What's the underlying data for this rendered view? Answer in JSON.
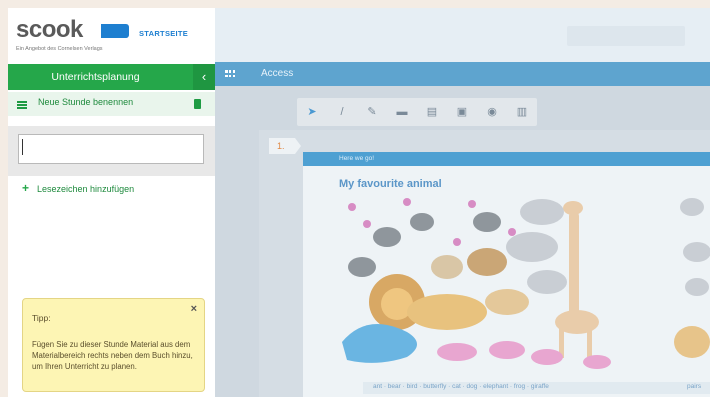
{
  "logo": {
    "word": "scook",
    "subtitle": "Ein Angebot des Cornelsen Verlags",
    "start_link": "STARTSEITE"
  },
  "sidebar": {
    "section_title": "Unterrichtsplanung",
    "back_glyph": "‹",
    "lesson_label": "Neue Stunde benennen",
    "lesson_input_value": "",
    "bookmark_plus": "+",
    "bookmark_label": "Lesezeichen hinzufügen",
    "tip": {
      "title": "Tipp:",
      "close_glyph": "×",
      "text": "Fügen Sie zu dieser Stunde Material aus dem Materialbereich rechts neben dem Buch hinzu, um Ihren Unterricht zu planen."
    }
  },
  "main": {
    "access_label": "Access",
    "tools": [
      {
        "name": "cursor-icon",
        "glyph": "➤",
        "active": true
      },
      {
        "name": "pen-icon",
        "glyph": "/"
      },
      {
        "name": "marker-icon",
        "glyph": "✎"
      },
      {
        "name": "note-icon",
        "glyph": "▬"
      },
      {
        "name": "layers-icon",
        "glyph": "▤"
      },
      {
        "name": "window-icon",
        "glyph": "▣"
      },
      {
        "name": "eye-icon",
        "glyph": "◉"
      },
      {
        "name": "trash-icon",
        "glyph": "▥"
      }
    ],
    "page_number": "1.",
    "section_label": "Here we go!",
    "page_title": "My favourite animal",
    "words": "ant · bear · bird · butterfly · cat · dog · elephant · frog · giraffe",
    "pairs": "pairs"
  },
  "colors": {
    "green": "#25a74a",
    "blue": "#5ea4cf",
    "tip_yellow": "#fdf5b4",
    "logo_blue": "#1e7fd0"
  }
}
